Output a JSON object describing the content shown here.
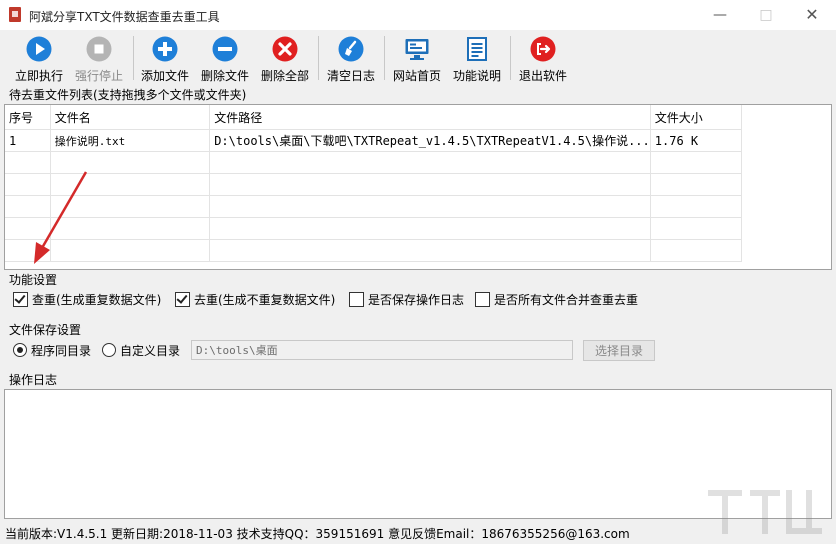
{
  "window": {
    "title": "阿斌分享TXT文件数据查重去重工具",
    "minimize_icon": "minimize-icon",
    "maximize_icon": "maximize-icon",
    "close_icon": "close-icon"
  },
  "toolbar": {
    "items": [
      {
        "label": "立即执行",
        "icon": "play-icon",
        "color": "#1e7fd8",
        "enabled": true
      },
      {
        "label": "强行停止",
        "icon": "stop-icon",
        "color": "#b4b4b4",
        "enabled": false
      },
      {
        "label": "添加文件",
        "icon": "plus-icon",
        "color": "#1e7fd8",
        "enabled": true
      },
      {
        "label": "删除文件",
        "icon": "minus-icon",
        "color": "#1e7fd8",
        "enabled": true
      },
      {
        "label": "删除全部",
        "icon": "x-icon",
        "color": "#e02020",
        "enabled": true
      },
      {
        "label": "清空日志",
        "icon": "broom-icon",
        "color": "#1e7fd8",
        "enabled": true
      },
      {
        "label": "网站首页",
        "icon": "monitor-icon",
        "color": "#1e6fb8",
        "enabled": true
      },
      {
        "label": "功能说明",
        "icon": "document-icon",
        "color": "#1e6fb8",
        "enabled": true
      },
      {
        "label": "退出软件",
        "icon": "exit-icon",
        "color": "#e02020",
        "enabled": true
      }
    ]
  },
  "file_list": {
    "label": "待去重文件列表(支持拖拽多个文件或文件夹)",
    "columns": [
      "序号",
      "文件名",
      "文件路径",
      "文件大小"
    ],
    "rows": [
      [
        "1",
        "操作说明.txt",
        "D:\\tools\\桌面\\下载吧\\TXTRepeat_v1.4.5\\TXTRepeatV1.4.5\\操作说...",
        "1.76 K"
      ]
    ]
  },
  "features": {
    "label": "功能设置",
    "options": [
      {
        "label": "查重(生成重复数据文件)",
        "checked": true
      },
      {
        "label": "去重(生成不重复数据文件)",
        "checked": true
      },
      {
        "label": "是否保存操作日志",
        "checked": false
      },
      {
        "label": "是否所有文件合并查重去重",
        "checked": false
      }
    ]
  },
  "save": {
    "label": "文件保存设置",
    "options": [
      {
        "label": "程序同目录",
        "selected": true
      },
      {
        "label": "自定义目录",
        "selected": false
      }
    ],
    "path_value": "D:\\tools\\桌面",
    "choose_button": "选择目录"
  },
  "log": {
    "label": "操作日志"
  },
  "statusbar": {
    "text": "当前版本:V1.4.5.1   更新日期:2018-11-03   技术支持QQ：359151691   意见反馈Email：18676355256@163.com"
  }
}
